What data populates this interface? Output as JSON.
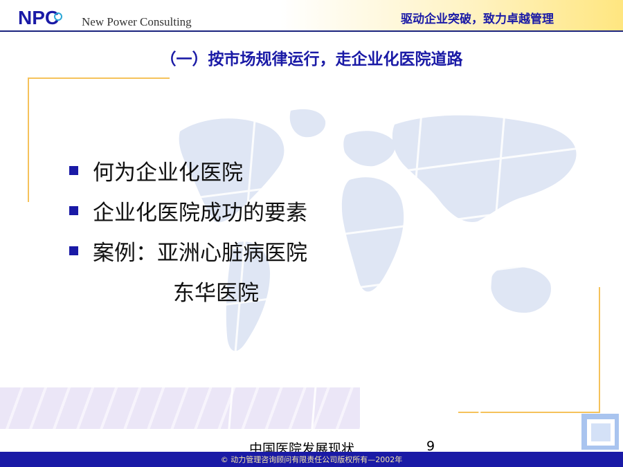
{
  "header": {
    "logo_text": "NPC",
    "company": "New Power Consulting",
    "slogan": "驱动企业突破，致力卓越管理"
  },
  "slide": {
    "title": "（一）按市场规律运行，走企业化医院道路",
    "bullets": [
      "何为企业化医院",
      "企业化医院成功的要素",
      "案例：亚洲心脏病医院"
    ],
    "bullet_continuation": "东华医院"
  },
  "footer": {
    "label": "中国医院发展现状",
    "page_number": "9",
    "copyright": "© 动力管理咨询顾问有限责任公司版权所有—2002年"
  },
  "colors": {
    "accent_blue": "#1a1aa6",
    "frame_gold": "#f5c25a",
    "map_fill": "#dfe6f4"
  },
  "icons": {
    "logo": "npc-logo-icon",
    "background": "world-map-icon",
    "corner": "corner-square-icon"
  }
}
